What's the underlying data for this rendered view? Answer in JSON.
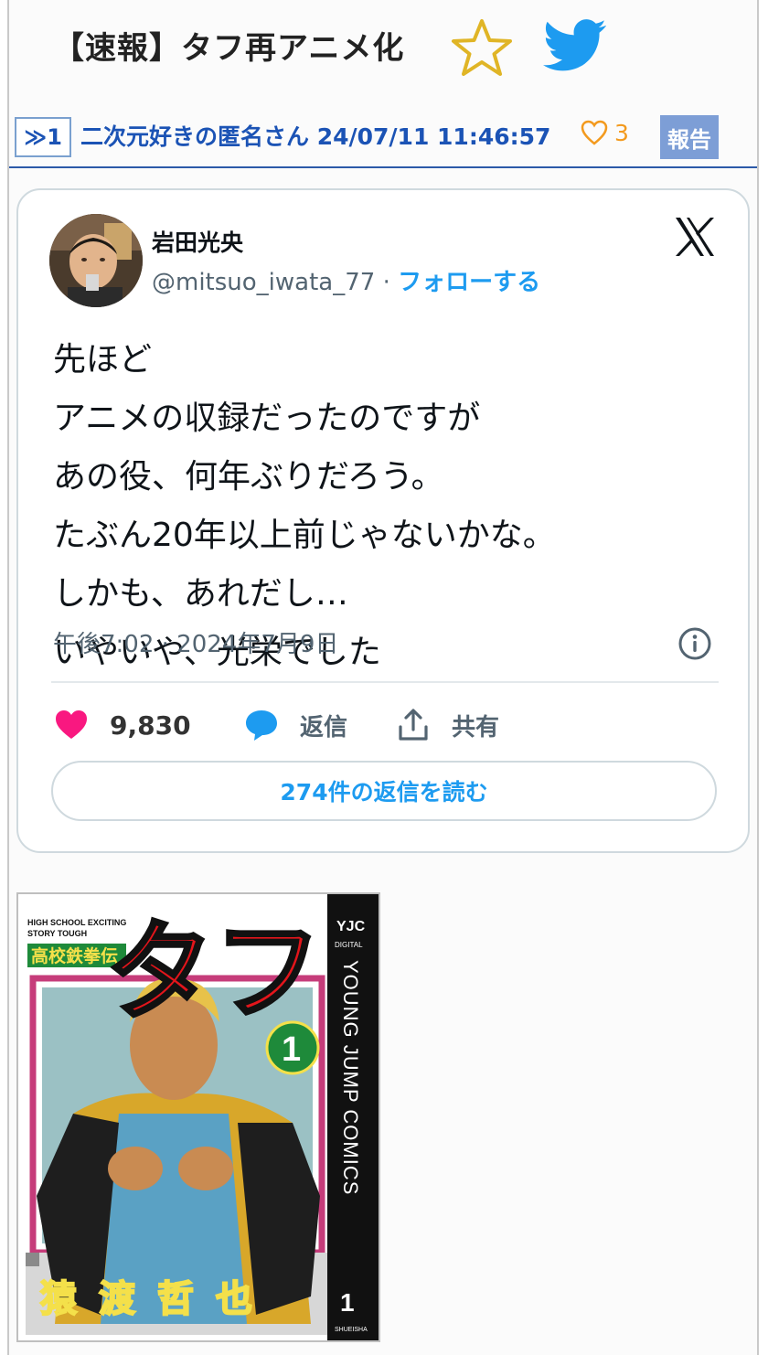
{
  "thread": {
    "title": "【速報】タフ再アニメ化"
  },
  "post": {
    "number": "≫1",
    "poster": "二次元好きの匿名さん 24/07/11 11:46:57",
    "like_count": "3",
    "report_label": "報告"
  },
  "tweet": {
    "author_name": "岩田光央",
    "handle": "@mitsuo_iwata_77",
    "separator": " · ",
    "follow_label": "フォローする",
    "text_lines": [
      "先ほど",
      "アニメの収録だったのですが",
      "あの役、何年ぶりだろう。",
      "たぶん20年以上前じゃないかな。",
      "しかも、あれだし…",
      "いやいや、光栄でした"
    ],
    "timestamp": "午後7:02 · 2024年7月9日",
    "like_count": "9,830",
    "reply_label": "返信",
    "share_label": "共有",
    "read_replies_label": "274件の返信を読む"
  },
  "cover": {
    "top_left_line1": "HIGH SCHOOL EXCITING",
    "top_left_line2": "STORY TOUGH",
    "subtitle": "高校鉄拳伝",
    "logo": "タフ",
    "volume": "1",
    "publisher": "YJC",
    "digital": "DIGITAL",
    "spine_text": "YOUNG JUMP COMICS",
    "author": "猿渡哲也",
    "spine_number": "1",
    "spine_small": "SHUEISHA"
  },
  "colors": {
    "link_blue": "#1b53b5",
    "twitter_blue": "#1d9bf0",
    "like_pink": "#f91880",
    "report_bg": "#7d9ed6",
    "star_gold": "#e0b526"
  },
  "icons": {
    "favorite": "star-outline-icon",
    "twitter": "twitter-bird-icon",
    "x": "x-logo-icon",
    "info": "info-icon",
    "heart": "heart-icon",
    "reply": "speech-bubble-icon",
    "share": "share-upload-icon"
  }
}
